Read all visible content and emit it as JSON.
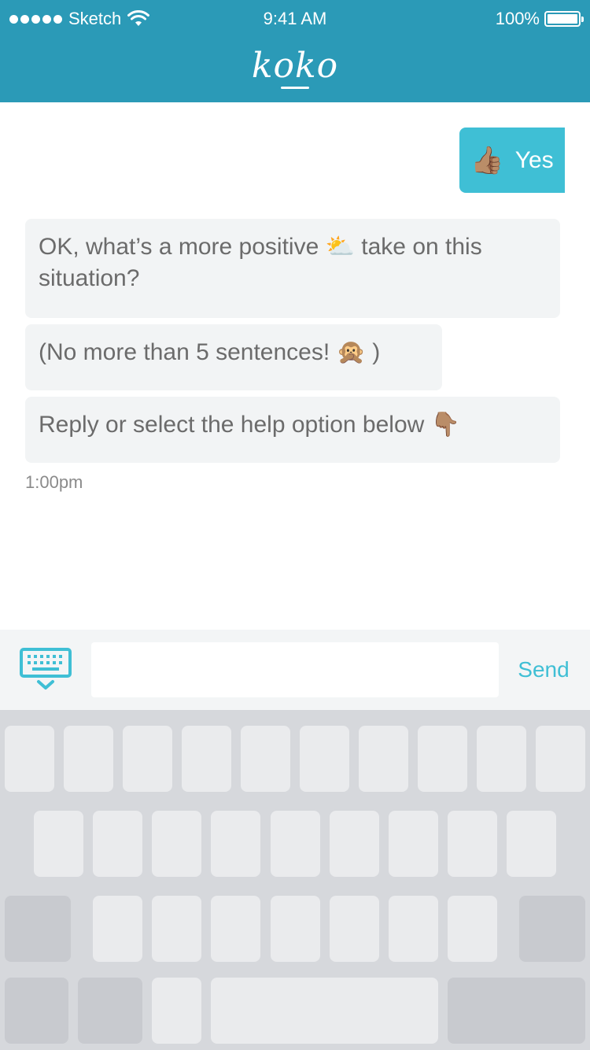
{
  "status_bar": {
    "carrier": "Sketch",
    "time": "9:41 AM",
    "battery": "100%",
    "battery_level": 1.0
  },
  "header": {
    "logo": "koko"
  },
  "messages": {
    "user_reply": {
      "emoji": "👍🏽",
      "text": "Yes"
    },
    "bot": [
      {
        "text": "OK, what’s a more positive ⛅ take on this situation?"
      },
      {
        "text": "(No more than 5 sentences! 🙊 )"
      },
      {
        "text": "Reply or select the help option below 👇🏽"
      }
    ],
    "timestamp": "1:00pm"
  },
  "composer": {
    "input_value": "",
    "send_label": "Send",
    "keyboard_toggle_icon": "keyboard-hide-icon"
  },
  "colors": {
    "brand": "#2b9ab7",
    "accent": "#3fbfd5",
    "bot_bubble": "#f2f4f5"
  }
}
